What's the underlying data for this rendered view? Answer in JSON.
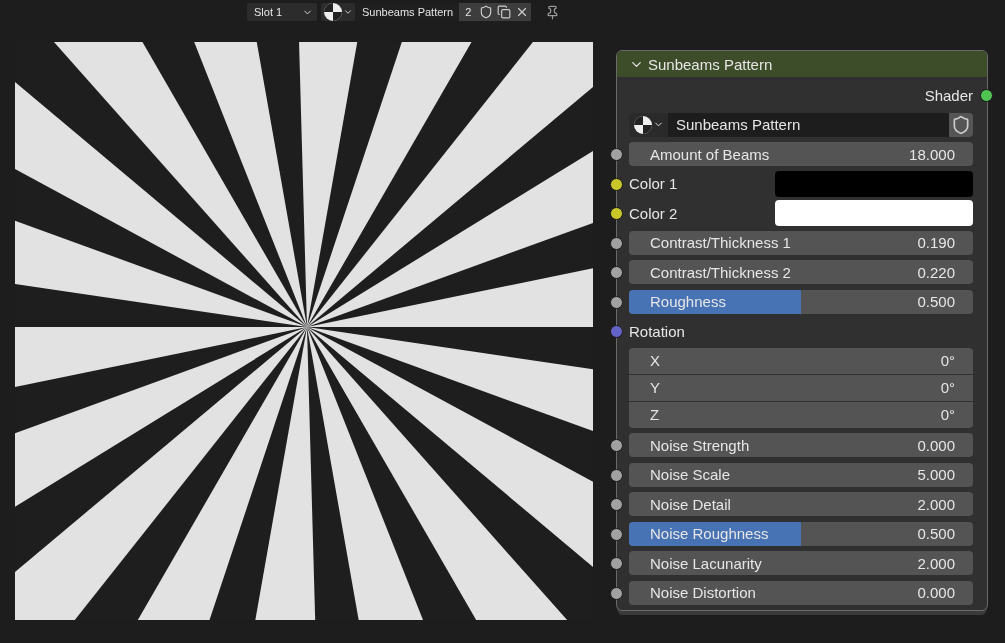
{
  "top_bar": {
    "slot": "Slot 1",
    "material_name": "Sunbeams Pattern",
    "users": "2"
  },
  "node": {
    "title": "Sunbeams Pattern",
    "expanded": true,
    "output": {
      "label": "Shader",
      "color": "#4fc252"
    },
    "group_name": "Sunbeams Pattern",
    "inputs": [
      {
        "kind": "number",
        "label": "Amount of Beams",
        "value": "18.000",
        "color": "#a1a1a1"
      },
      {
        "kind": "color",
        "label": "Color 1",
        "swatch": {
          "color": "#000000"
        },
        "color": "#c7c729"
      },
      {
        "kind": "color",
        "label": "Color 2",
        "swatch": {
          "color": "#ffffff"
        },
        "color": "#c7c729"
      },
      {
        "kind": "number",
        "label": "Contrast/Thickness 1",
        "value": "0.190",
        "color": "#a1a1a1"
      },
      {
        "kind": "number",
        "label": "Contrast/Thickness 2",
        "value": "0.220",
        "color": "#a1a1a1"
      },
      {
        "kind": "slider",
        "label": "Roughness",
        "value": "0.500",
        "level": 0.5,
        "color": "#a1a1a1"
      },
      {
        "kind": "vector",
        "label": "Rotation",
        "color": "#6363c7",
        "components": [
          {
            "label": "X",
            "value": "0°"
          },
          {
            "label": "Y",
            "value": "0°"
          },
          {
            "label": "Z",
            "value": "0°"
          }
        ]
      },
      {
        "kind": "number",
        "label": "Noise Strength",
        "value": "0.000",
        "color": "#a1a1a1"
      },
      {
        "kind": "number",
        "label": "Noise Scale",
        "value": "5.000",
        "color": "#a1a1a1"
      },
      {
        "kind": "number",
        "label": "Noise Detail",
        "value": "2.000",
        "color": "#a1a1a1"
      },
      {
        "kind": "slider",
        "label": "Noise Roughness",
        "value": "0.500",
        "level": 0.5,
        "color": "#a1a1a1"
      },
      {
        "kind": "number",
        "label": "Noise Lacunarity",
        "value": "2.000",
        "color": "#a1a1a1"
      },
      {
        "kind": "number",
        "label": "Noise Distortion",
        "value": "0.000",
        "color": "#a1a1a1"
      }
    ]
  }
}
